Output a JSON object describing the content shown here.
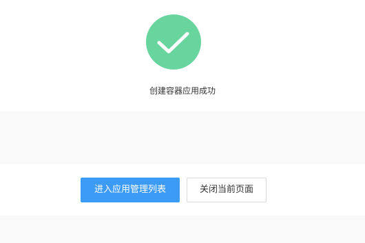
{
  "result": {
    "icon": "checkmark-icon",
    "icon_color": "#67d59d",
    "message": "创建容器应用成功"
  },
  "actions": {
    "primary_label": "进入应用管理列表",
    "secondary_label": "关闭当前页面",
    "primary_color": "#3d9bf8"
  }
}
